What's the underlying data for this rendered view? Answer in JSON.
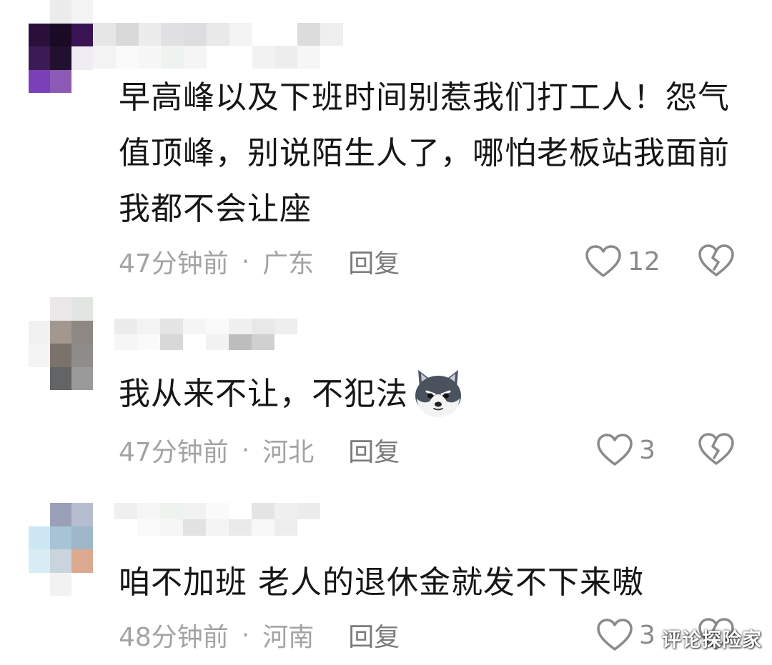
{
  "comments": [
    {
      "text": "早高峰以及下班时间别惹我们打工人！怨气值顶峰，别说陌生人了，哪怕老板站我面前我都不会让座",
      "time": "47分钟前",
      "location": "广东",
      "reply_label": "回复",
      "likes": "12"
    },
    {
      "text": "我从来不让，不犯法",
      "emoji": "husky-dog-emoji",
      "time": "47分钟前",
      "location": "河北",
      "reply_label": "回复",
      "likes": "3"
    },
    {
      "text": "咱不加班 老人的退休金就发不下来嗷",
      "time": "48分钟前",
      "location": "河南",
      "reply_label": "回复",
      "likes": "3"
    }
  ],
  "separator": "·",
  "watermark": "评论探险家",
  "colors": {
    "text": "#161616",
    "meta": "#a3a3a3",
    "icon": "#8a8a8a",
    "background": "#ffffff"
  },
  "icons": {
    "like": "heart-outline-icon",
    "dislike": "broken-heart-icon"
  }
}
